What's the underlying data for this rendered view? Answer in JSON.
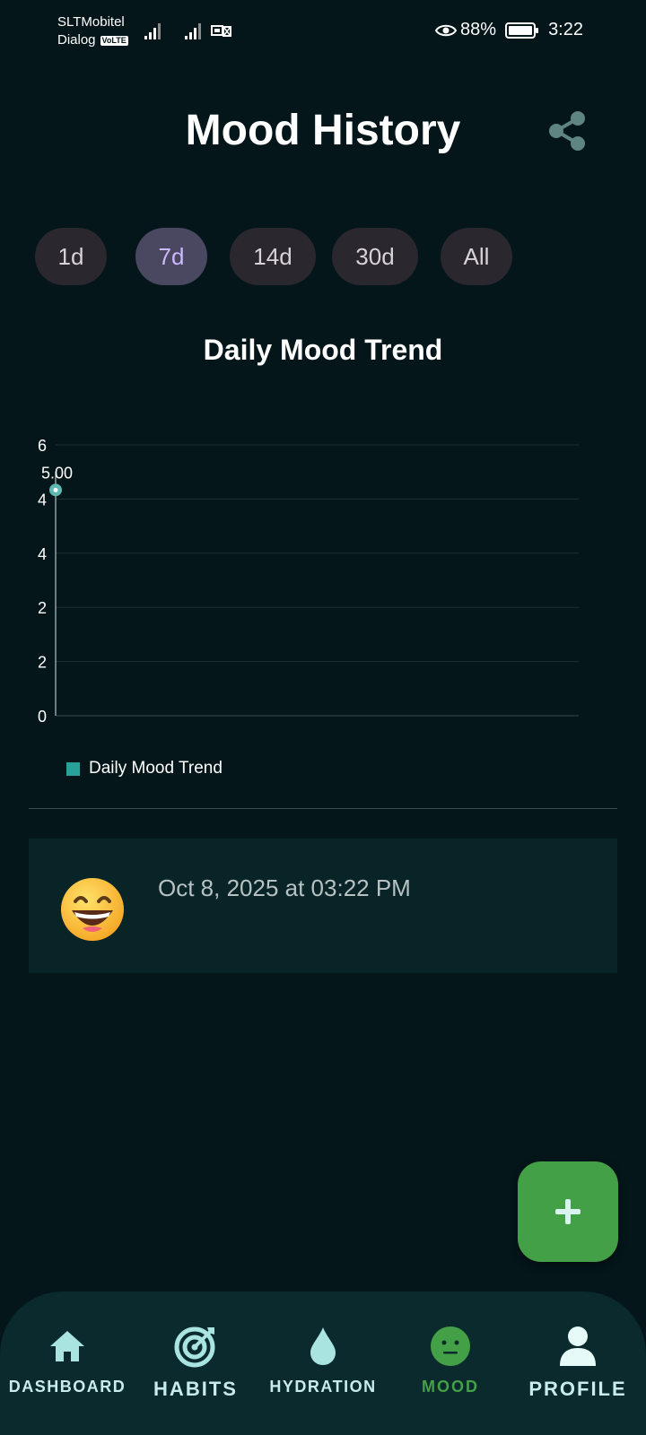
{
  "status_bar": {
    "carrier_1": "SLTMobitel",
    "carrier_2": "Dialog",
    "volte_badge": "VoLTE",
    "battery": "88%",
    "time": "3:22"
  },
  "header": {
    "title": "Mood History",
    "share_icon": "share-icon"
  },
  "range_chips": [
    {
      "label": "1d",
      "selected": false
    },
    {
      "label": "7d",
      "selected": true
    },
    {
      "label": "14d",
      "selected": false
    },
    {
      "label": "30d",
      "selected": false
    },
    {
      "label": "All",
      "selected": false
    }
  ],
  "chart_data": {
    "type": "line",
    "title": "Daily Mood Trend",
    "series": [
      {
        "name": "Daily Mood Trend",
        "values": [
          5.0
        ],
        "color": "#5fb8b2"
      }
    ],
    "point_labels": [
      "5.00"
    ],
    "y_tick_labels": [
      "6",
      "4",
      "4",
      "2",
      "2",
      "0"
    ],
    "ylim": [
      0,
      6
    ],
    "grid": true,
    "legend_position": "bottom-left"
  },
  "entries": [
    {
      "emoji": "grinning-face-icon",
      "date": "Oct 8, 2025 at 03:22 PM"
    }
  ],
  "fab": {
    "icon": "plus-icon"
  },
  "bottom_nav": [
    {
      "label": "DASHBOARD",
      "icon": "home-icon",
      "active": false
    },
    {
      "label": "HABITS",
      "icon": "target-icon",
      "active": false
    },
    {
      "label": "HYDRATION",
      "icon": "water-drop-icon",
      "active": false
    },
    {
      "label": "MOOD",
      "icon": "neutral-face-icon",
      "active": true
    },
    {
      "label": "PROFILE",
      "icon": "person-icon",
      "active": false
    }
  ],
  "colors": {
    "background": "#04161a",
    "accent_green": "#43a047",
    "chip_selected": "#4a4760",
    "chip_default": "#2a272e",
    "nav_background": "#0b2a2e",
    "card_background": "#082427"
  }
}
